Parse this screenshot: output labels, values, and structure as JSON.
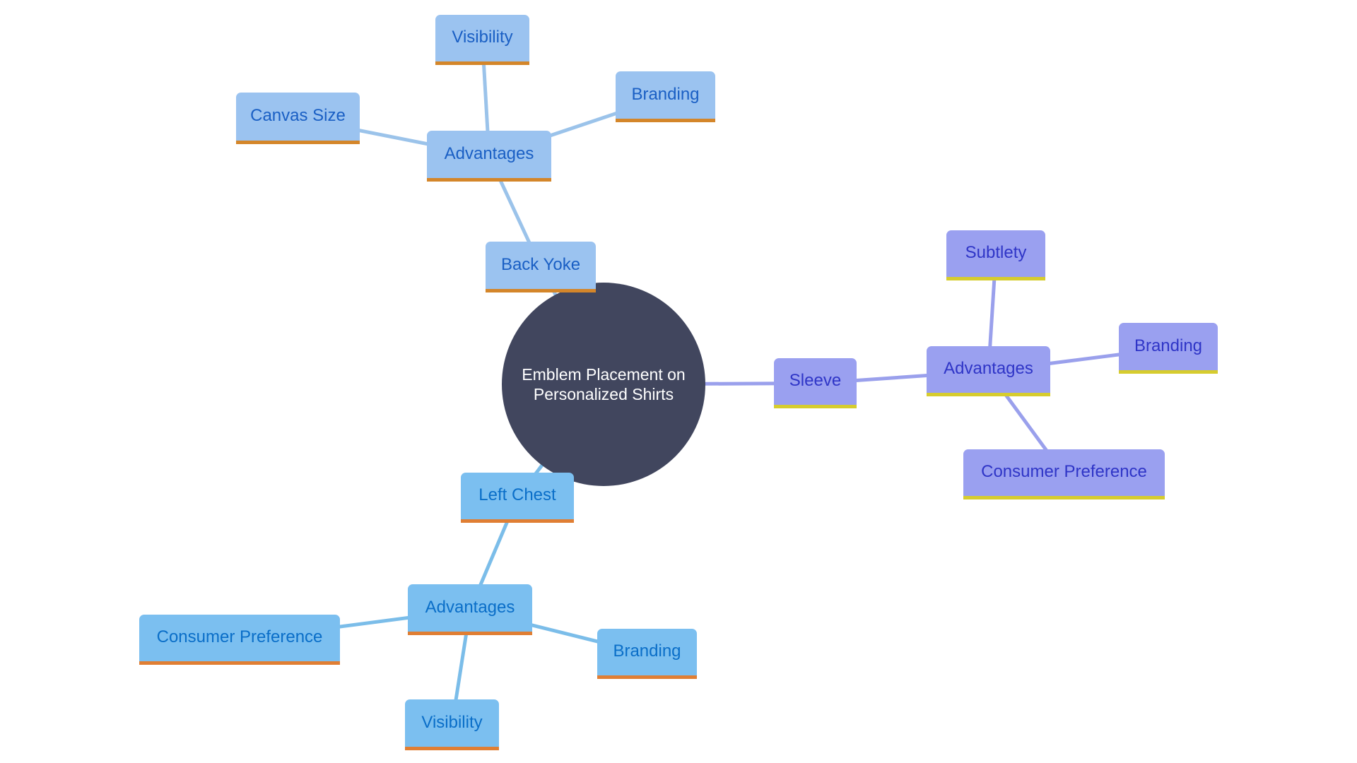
{
  "diagram": {
    "type": "mindmap",
    "root": {
      "label": "Emblem Placement on Personalized Shirts",
      "fill": "#41465e",
      "text_color": "#ffffff"
    },
    "themes": {
      "back_yoke": {
        "fill": "#9bc3f0",
        "border": "#d4862a",
        "text": "#1a5fc4",
        "edge": "#9bc3ea"
      },
      "sleeve": {
        "fill": "#9aa0f0",
        "border": "#d6cc2e",
        "text": "#2f35c7",
        "edge": "#9aa0ec"
      },
      "left_chest": {
        "fill": "#7bbff0",
        "border": "#e07e33",
        "text": "#0a6ec8",
        "edge": "#7bbde9"
      }
    },
    "branches": [
      {
        "id": "back_yoke",
        "label": "Back Yoke",
        "children": [
          {
            "label": "Advantages",
            "children": [
              {
                "label": "Visibility"
              },
              {
                "label": "Branding"
              },
              {
                "label": "Canvas Size"
              }
            ]
          }
        ]
      },
      {
        "id": "sleeve",
        "label": "Sleeve",
        "children": [
          {
            "label": "Advantages",
            "children": [
              {
                "label": "Subtlety"
              },
              {
                "label": "Branding"
              },
              {
                "label": "Consumer Preference"
              }
            ]
          }
        ]
      },
      {
        "id": "left_chest",
        "label": "Left Chest",
        "children": [
          {
            "label": "Advantages",
            "children": [
              {
                "label": "Consumer Preference"
              },
              {
                "label": "Branding"
              },
              {
                "label": "Visibility"
              }
            ]
          }
        ]
      }
    ]
  }
}
